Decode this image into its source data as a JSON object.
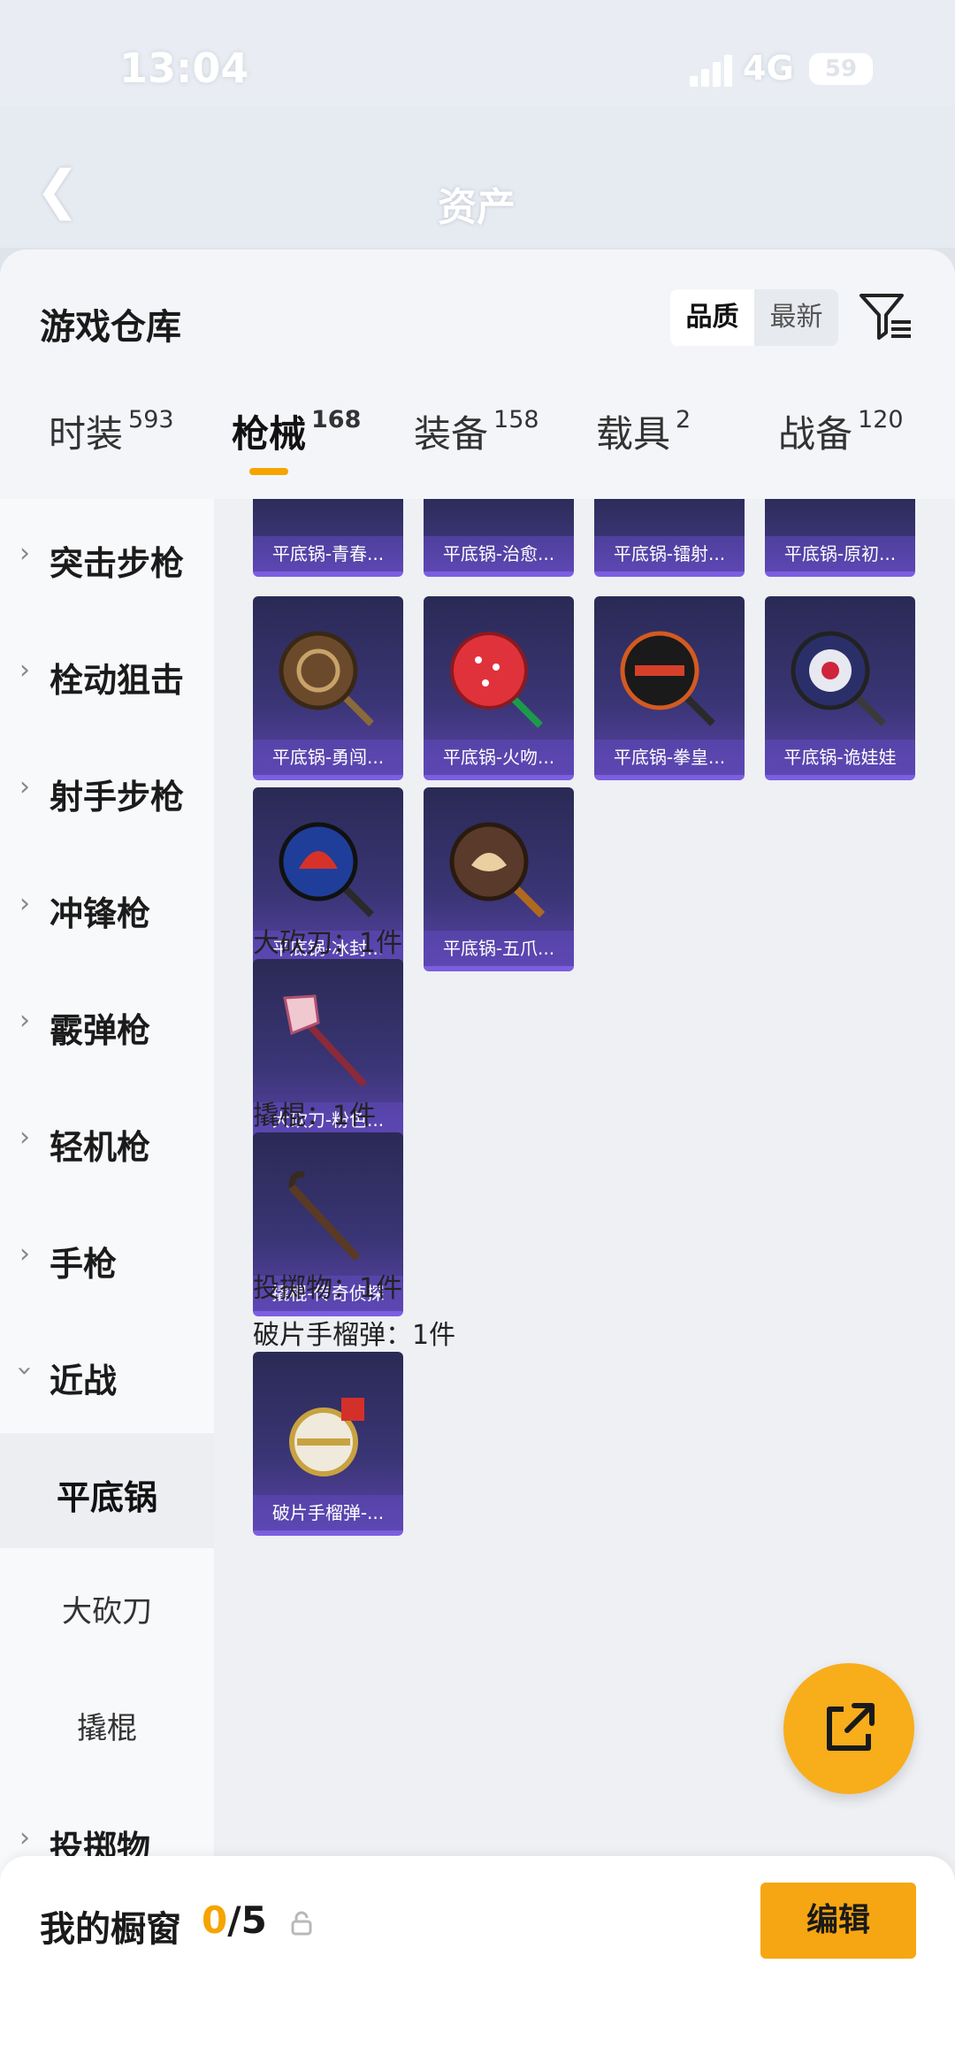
{
  "status_bar": {
    "time": "13:04",
    "network": "4G",
    "battery": "59"
  },
  "nav": {
    "title": "资产"
  },
  "sheet": {
    "title": "游戏仓库",
    "sort": [
      "品质",
      "最新"
    ],
    "active_sort": "品质"
  },
  "tabs": [
    {
      "label": "时装",
      "count": "593"
    },
    {
      "label": "枪械",
      "count": "168"
    },
    {
      "label": "装备",
      "count": "158"
    },
    {
      "label": "载具",
      "count": "2"
    },
    {
      "label": "战备",
      "count": "120"
    }
  ],
  "active_tab": "枪械",
  "sidebar": [
    {
      "label": "突击步枪"
    },
    {
      "label": "栓动狙击"
    },
    {
      "label": "射手步枪"
    },
    {
      "label": "冲锋枪"
    },
    {
      "label": "霰弹枪"
    },
    {
      "label": "轻机枪"
    },
    {
      "label": "手枪"
    },
    {
      "label": "近战"
    },
    {
      "label": "平底锅"
    },
    {
      "label": "大砍刀"
    },
    {
      "label": "撬棍"
    },
    {
      "label": "投掷物"
    }
  ],
  "items": {
    "pan_row1": [
      "平底锅-青春...",
      "平底锅-治愈...",
      "平底锅-镭射...",
      "平底锅-原初..."
    ],
    "pan_row2": [
      "平底锅-勇闯...",
      "平底锅-火吻...",
      "平底锅-拳皇...",
      "平底锅-诡娃娃"
    ],
    "pan_row3": [
      "平底锅-冰封...",
      "平底锅-五爪..."
    ],
    "machete_header": "大砍刀：1件",
    "machete": [
      "大砍刀-粉色..."
    ],
    "crowbar_header": "撬棍：1件",
    "crowbar": [
      "撬棍-传奇侦探"
    ],
    "throwable_header": "投掷物：1件",
    "grenade_header": "破片手榴弹：1件",
    "grenade": [
      "破片手榴弹-..."
    ]
  },
  "bottom": {
    "label": "我的橱窗",
    "count_a": "0",
    "count_b": "/5",
    "edit": "编辑"
  },
  "colors": {
    "accent": "#f5a400",
    "card": "#3a3575"
  }
}
